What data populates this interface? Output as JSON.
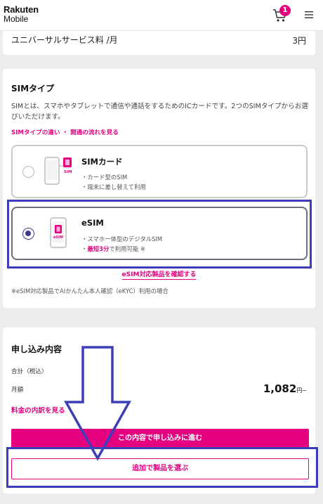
{
  "header": {
    "logo_line1": "Rakuten",
    "logo_line2": "Mobile",
    "cart_count": "1",
    "cart_icon": "cart-icon",
    "menu_icon": "hamburger-menu-icon"
  },
  "universal_fee": {
    "label": "ユニバーサルサービス料 /月",
    "value": "3円"
  },
  "sim_type": {
    "title": "SIMタイプ",
    "description": "SIMとは、スマホやタブレットで通信や通話をするためのICカードです。2つのSIMタイプからお選びいただけます。",
    "links_text": "SIMタイプの違い ・ 開通の流れを見る",
    "options": [
      {
        "title": "SIMカード",
        "lines": [
          "・カード型のSIM",
          "・端末に差し替えて利用"
        ],
        "selected": false,
        "icon": "sim-card-phone-icon",
        "icon_label": "SIM"
      },
      {
        "title": "eSIM",
        "lines": [
          "・スマホ一体型のデジタルSIM"
        ],
        "line2_prefix": "・",
        "line2_highlight": "最短3分",
        "line2_suffix": "で利用可能 ※",
        "selected": true,
        "icon": "esim-phone-icon",
        "icon_label": "eSIM"
      }
    ],
    "check_link": "eSIM対応製品を確認する",
    "note": "※eSIM対応製品でAIかんたん本人確認（eKYC）利用の場合"
  },
  "order": {
    "title": "申し込み内容",
    "total_label": "合計（税込）",
    "monthly_label": "月額",
    "monthly_value": "1,082",
    "monthly_unit": "円~",
    "breakdown_link": "料金の内訳を見る",
    "primary_button": "この内容で申し込みに進む",
    "secondary_button": "追加で製品を選ぶ"
  },
  "colors": {
    "brand": "#e4007f",
    "annotation": "#3d3fb8",
    "radio_selected": "#3c3a8e"
  }
}
